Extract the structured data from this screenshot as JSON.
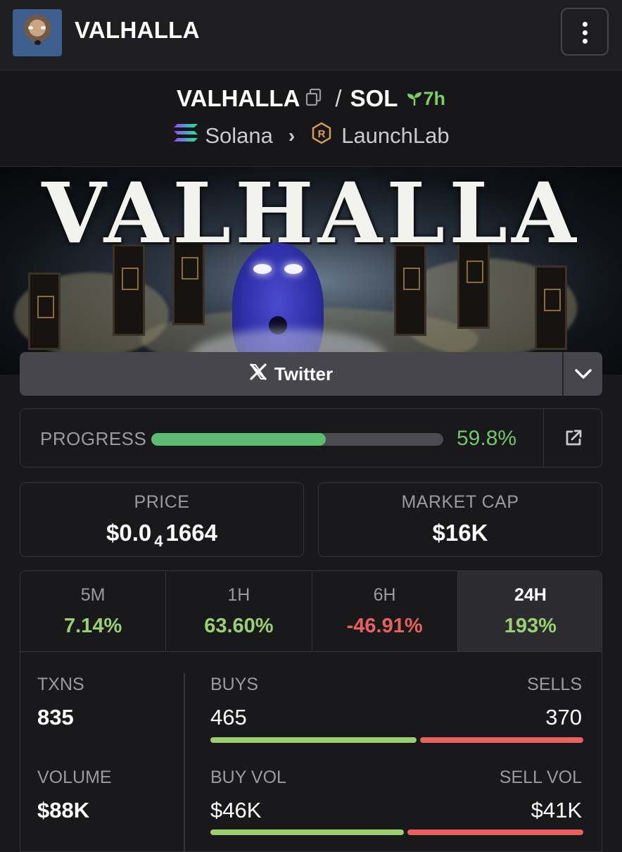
{
  "header": {
    "title": "VALHALLA",
    "menu_icon": "kebab-menu-icon"
  },
  "pair": {
    "base": "VALHALLA",
    "separator": "/",
    "quote": "SOL",
    "age": "7h",
    "chain": "Solana",
    "dex": "LaunchLab"
  },
  "banner": {
    "art_text": "VALHALLA"
  },
  "social": {
    "twitter_label": "Twitter"
  },
  "progress": {
    "label": "PROGRESS",
    "value_text": "59.8%",
    "fraction": 0.598
  },
  "stats": {
    "price_label": "PRICE",
    "price_prefix": "$0.0",
    "price_zeros": "4",
    "price_digits": "1664",
    "mcap_label": "MARKET CAP",
    "mcap_value": "$16K"
  },
  "timeframes": [
    {
      "label": "5M",
      "value": "7.14%",
      "direction": "up"
    },
    {
      "label": "1H",
      "value": "63.60%",
      "direction": "up"
    },
    {
      "label": "6H",
      "value": "-46.91%",
      "direction": "down"
    },
    {
      "label": "24H",
      "value": "193%",
      "direction": "up",
      "selected": true
    }
  ],
  "metrics": {
    "txns_label": "TXNS",
    "txns_value": "835",
    "buys_label": "BUYS",
    "buys_value": "465",
    "sells_label": "SELLS",
    "sells_value": "370",
    "volume_label": "VOLUME",
    "volume_value": "$88K",
    "buy_vol_label": "BUY VOL",
    "buy_vol_value": "$46K",
    "sell_vol_label": "SELL VOL",
    "sell_vol_value": "$41K",
    "buy_share_txns": 0.557,
    "buy_share_volume": 0.523
  },
  "colors": {
    "positive": "#9ad06f",
    "negative": "#e8615c",
    "progress": "#5cbc6f",
    "background": "#19191c"
  }
}
